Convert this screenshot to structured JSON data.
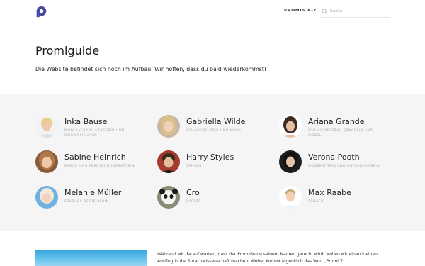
{
  "header": {
    "logo_letter": "P",
    "brand_color": "#4a4aa5",
    "nav_label": "PROMIS A-Z",
    "search_placeholder": "Suche",
    "search_value": ""
  },
  "intro": {
    "title": "Promiguide",
    "subtitle": "Die Website befindet sich noch im Aufbau. Wir hoffen, dass du bald wiederkommst!"
  },
  "celebrities": [
    {
      "name": "Inka Bause",
      "role": "MODERATORIN, SÄNGERIN UND SCHAUSPIELERIN"
    },
    {
      "name": "Gabriella Wilde",
      "role": "SCHAUSPIELERIN UND MODEL"
    },
    {
      "name": "Ariana Grande",
      "role": "SCHAUSPIELERIN, SÄNGERIN UND MODEL"
    },
    {
      "name": "Sabine Heinrich",
      "role": "RADIO- UND FERNSEHMODERATORIN"
    },
    {
      "name": "Harry Styles",
      "role": "SÄNGER"
    },
    {
      "name": "Verona Pooth",
      "role": "MODERATORIN UND UNTERNEHMERIN"
    },
    {
      "name": "Melanie Müller",
      "role": "SEXSHOP-BETREIBERIN"
    },
    {
      "name": "Cro",
      "role": "RAPPER"
    },
    {
      "name": "Max Raabe",
      "role": "SÄNGER"
    }
  ],
  "article": {
    "text": "Während wir darauf warten, dass der PromiGuide seinem Namen gerecht wird, wollen wir einen kleinen Ausflug in die Sprachwissenschaft machen: Woher kommt eigentlich das Wort „Promi“?"
  }
}
